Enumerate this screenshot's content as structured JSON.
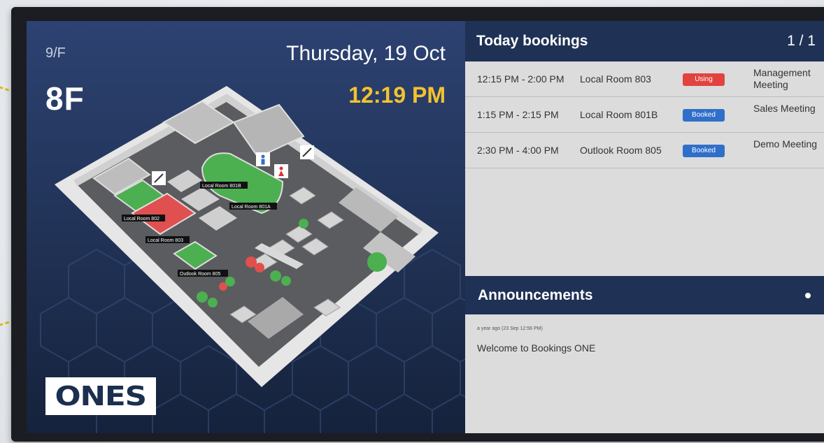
{
  "left_panel": {
    "floor_small": "9/F",
    "floor_large": "8F",
    "date": "Thursday, 19 Oct",
    "time": "12:19 PM",
    "logo": "ONES",
    "map_labels": [
      "Local Room 801B",
      "Local Room 801A",
      "Local Room 802",
      "Local Room 803",
      "Outlook Room 805"
    ]
  },
  "bookings": {
    "title": "Today bookings",
    "page": "1 / 1",
    "rows": [
      {
        "time": "12:15 PM - 2:00 PM",
        "room": "Local Room 803",
        "status": "Using",
        "subject": "Management Meeting"
      },
      {
        "time": "1:15 PM - 2:15 PM",
        "room": "Local Room 801B",
        "status": "Booked",
        "subject": "Sales Meeting"
      },
      {
        "time": "2:30 PM - 4:00 PM",
        "room": "Outlook Room 805",
        "status": "Booked",
        "subject": "Demo Meeting"
      }
    ]
  },
  "announcements": {
    "title": "Announcements",
    "items": [
      {
        "meta": "a year ago (23 Sep 12:56 PM)",
        "text": "Welcome to Bookings ONE"
      }
    ]
  },
  "colors": {
    "header_navy": "#1f3155",
    "time_yellow": "#f2c230",
    "status_using": "#e2433f",
    "status_booked": "#2f6fc9",
    "room_in_use": "#e05050",
    "room_available": "#4caf50"
  }
}
